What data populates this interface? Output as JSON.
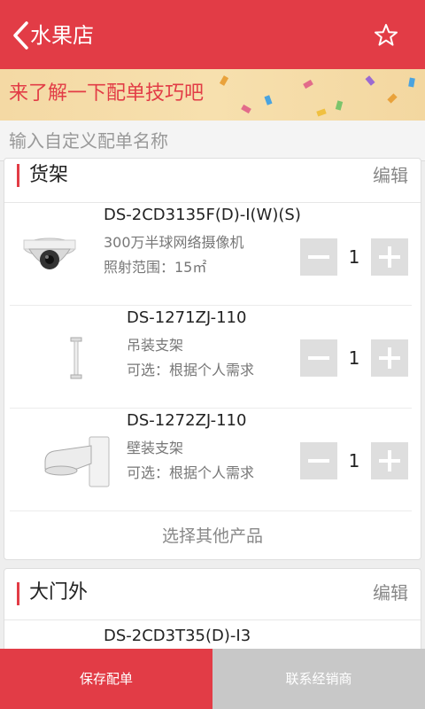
{
  "header": {
    "title": "水果店",
    "back_icon": "chevron-left-icon",
    "favorite_icon": "star-outline-icon",
    "color": "#e23c46"
  },
  "banner": {
    "text": "来了解一下配单技巧吧"
  },
  "order_name": {
    "placeholder": "输入自定义配单名称",
    "value": ""
  },
  "sections": [
    {
      "name": "货架",
      "edit_label": "编辑",
      "items": [
        {
          "model": "DS-2CD3135F(D)-I(W)(S)",
          "description": "300万半球网络摄像机",
          "note": "照射范围：15㎡",
          "quantity": "1"
        },
        {
          "model": "DS-1271ZJ-110",
          "description": "吊装支架",
          "note": "可选：根据个人需求",
          "quantity": "1"
        },
        {
          "model": "DS-1272ZJ-110",
          "description": "壁装支架",
          "note": "可选：根据个人需求",
          "quantity": "1"
        }
      ],
      "select_other_label": "选择其他产品"
    },
    {
      "name": "大门外",
      "edit_label": "编辑",
      "items": [
        {
          "model": "DS-2CD3T35(D)-I3"
        }
      ]
    }
  ],
  "footer": {
    "save_label": "保存配单",
    "contact_label": "联系经销商"
  }
}
